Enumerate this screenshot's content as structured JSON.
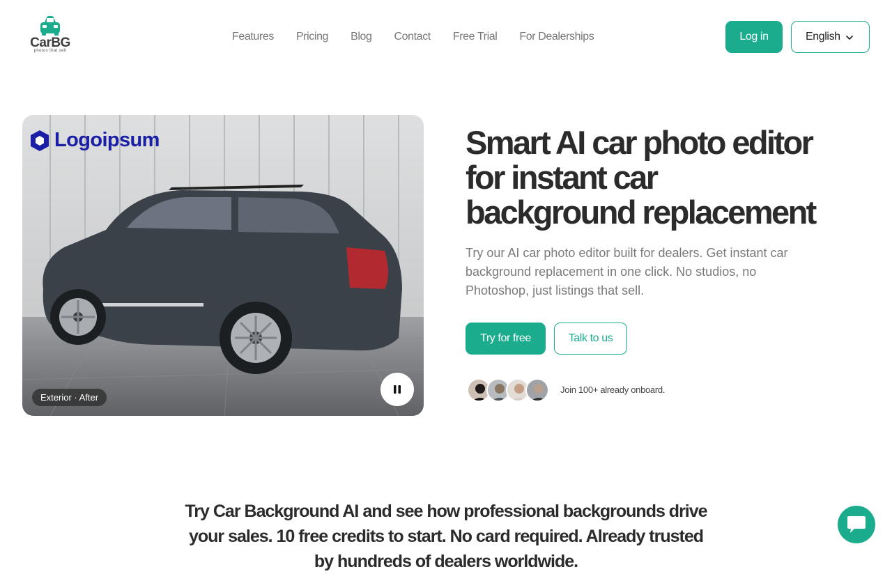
{
  "brand": {
    "name": "CarBG",
    "tagline": "photos that sell",
    "accent_color": "#1bac8d"
  },
  "nav": {
    "items": [
      {
        "label": "Features"
      },
      {
        "label": "Pricing"
      },
      {
        "label": "Blog"
      },
      {
        "label": "Contact"
      },
      {
        "label": "Free Trial"
      },
      {
        "label": "For Dealerships"
      }
    ]
  },
  "header": {
    "login_label": "Log in",
    "language": "English"
  },
  "hero": {
    "media": {
      "overlay_logo_text": "Logoipsum",
      "caption": "Exterior · After",
      "control_icon": "pause-icon"
    },
    "title": "Smart AI car photo editor for instant car background replacement",
    "subtitle": "Try our AI car photo editor built for dealers. Get instant car background replacement in one click. No studios, no Photoshop, just listings that sell.",
    "primary_cta": "Try for free",
    "secondary_cta": "Talk to us",
    "social_proof": "Join 100+ already onboard."
  },
  "section": {
    "heading": "Try Car Background AI and see how professional backgrounds drive your sales. 10 free credits to start. No card required. Already trusted by hundreds of dealers worldwide."
  },
  "chat": {
    "icon": "chat-icon"
  }
}
